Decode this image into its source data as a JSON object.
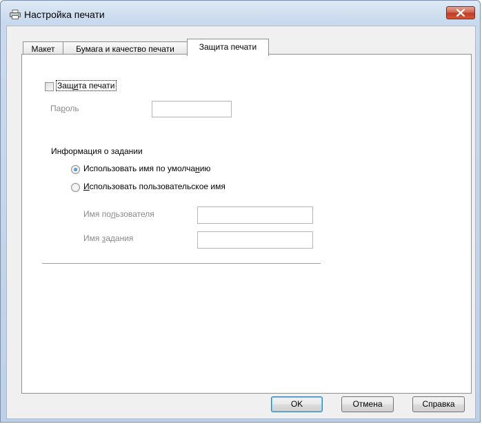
{
  "window": {
    "title": "Настройка печати",
    "accent": "#c03a21"
  },
  "tabs": [
    {
      "label": "Макет"
    },
    {
      "label": "Бумага и качество печати"
    },
    {
      "label": "Защита печати",
      "active": true
    }
  ],
  "protection": {
    "checkbox_pre": "Защ",
    "checkbox_ul": "и",
    "checkbox_post": "та печати",
    "checked": false,
    "password_pre": "Па",
    "password_ul": "р",
    "password_post": "оль",
    "password_value": ""
  },
  "job_info": {
    "heading": "Информация о задании",
    "radio_default_pre": "Использовать имя по умолча",
    "radio_default_ul": "н",
    "radio_default_post": "ию",
    "radio_custom_ul": "И",
    "radio_custom_post": "спользовать пользовательское имя",
    "selected": "default",
    "username_pre": "Имя по",
    "username_ul": "л",
    "username_post": "ьзователя",
    "username_value": "",
    "jobname_pre": "Имя ",
    "jobname_ul": "з",
    "jobname_post": "адания",
    "jobname_value": ""
  },
  "buttons": {
    "ok": "OK",
    "cancel": "Отмена",
    "help": "Справка"
  },
  "icons": {
    "title": "printer-icon",
    "close": "close-icon"
  }
}
